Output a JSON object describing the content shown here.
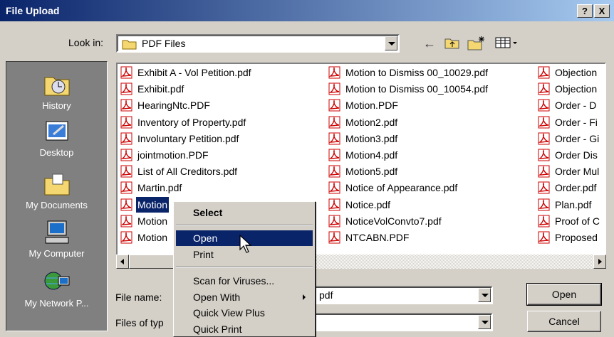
{
  "window": {
    "title": "File Upload",
    "help_label": "?",
    "close_label": "X"
  },
  "lookin": {
    "label": "Look in:",
    "value": "PDF Files"
  },
  "places": [
    {
      "label": "History",
      "icon": "history-icon"
    },
    {
      "label": "Desktop",
      "icon": "desktop-icon"
    },
    {
      "label": "My Documents",
      "icon": "my-documents-icon"
    },
    {
      "label": "My Computer",
      "icon": "my-computer-icon"
    },
    {
      "label": "My Network P...",
      "icon": "my-network-places-icon"
    }
  ],
  "files": {
    "col1": [
      "Exhibit A - Vol Petition.pdf",
      "Exhibit.pdf",
      "HearingNtc.PDF",
      "Inventory of Property.pdf",
      "Involuntary Petition.pdf",
      "jointmotion.PDF",
      "List of All Creditors.pdf",
      "Martin.pdf",
      "Motion",
      "Motion",
      "Motion"
    ],
    "col2": [
      "Motion to Dismiss 00_10029.pdf",
      "Motion to Dismiss 00_10054.pdf",
      "Motion.PDF",
      "Motion2.pdf",
      "Motion3.pdf",
      "Motion4.pdf",
      "Motion5.pdf",
      "Notice of Appearance.pdf",
      "Notice.pdf",
      "NoticeVolConvto7.pdf",
      "NTCABN.PDF"
    ],
    "col3": [
      "Objection",
      "Objection",
      "Order - D",
      "Order - Fi",
      "Order - Gi",
      "Order Dis",
      "Order Mul",
      "Order.pdf",
      "Plan.pdf",
      "Proof of C",
      "Proposed"
    ]
  },
  "filename": {
    "label": "File name:",
    "value": "pdf"
  },
  "filetype": {
    "label": "Files of typ",
    "value": ""
  },
  "buttons": {
    "open": "Open",
    "cancel": "Cancel"
  },
  "context_menu": {
    "items": [
      "Select",
      "Open",
      "Print",
      "Scan for Viruses...",
      "Open With",
      "Quick View Plus",
      "Quick Print"
    ]
  },
  "colors": {
    "title_start": "#0a246a",
    "title_end": "#a6caf0",
    "highlight": "#0a246a",
    "pdf_red": "#cc0000"
  }
}
